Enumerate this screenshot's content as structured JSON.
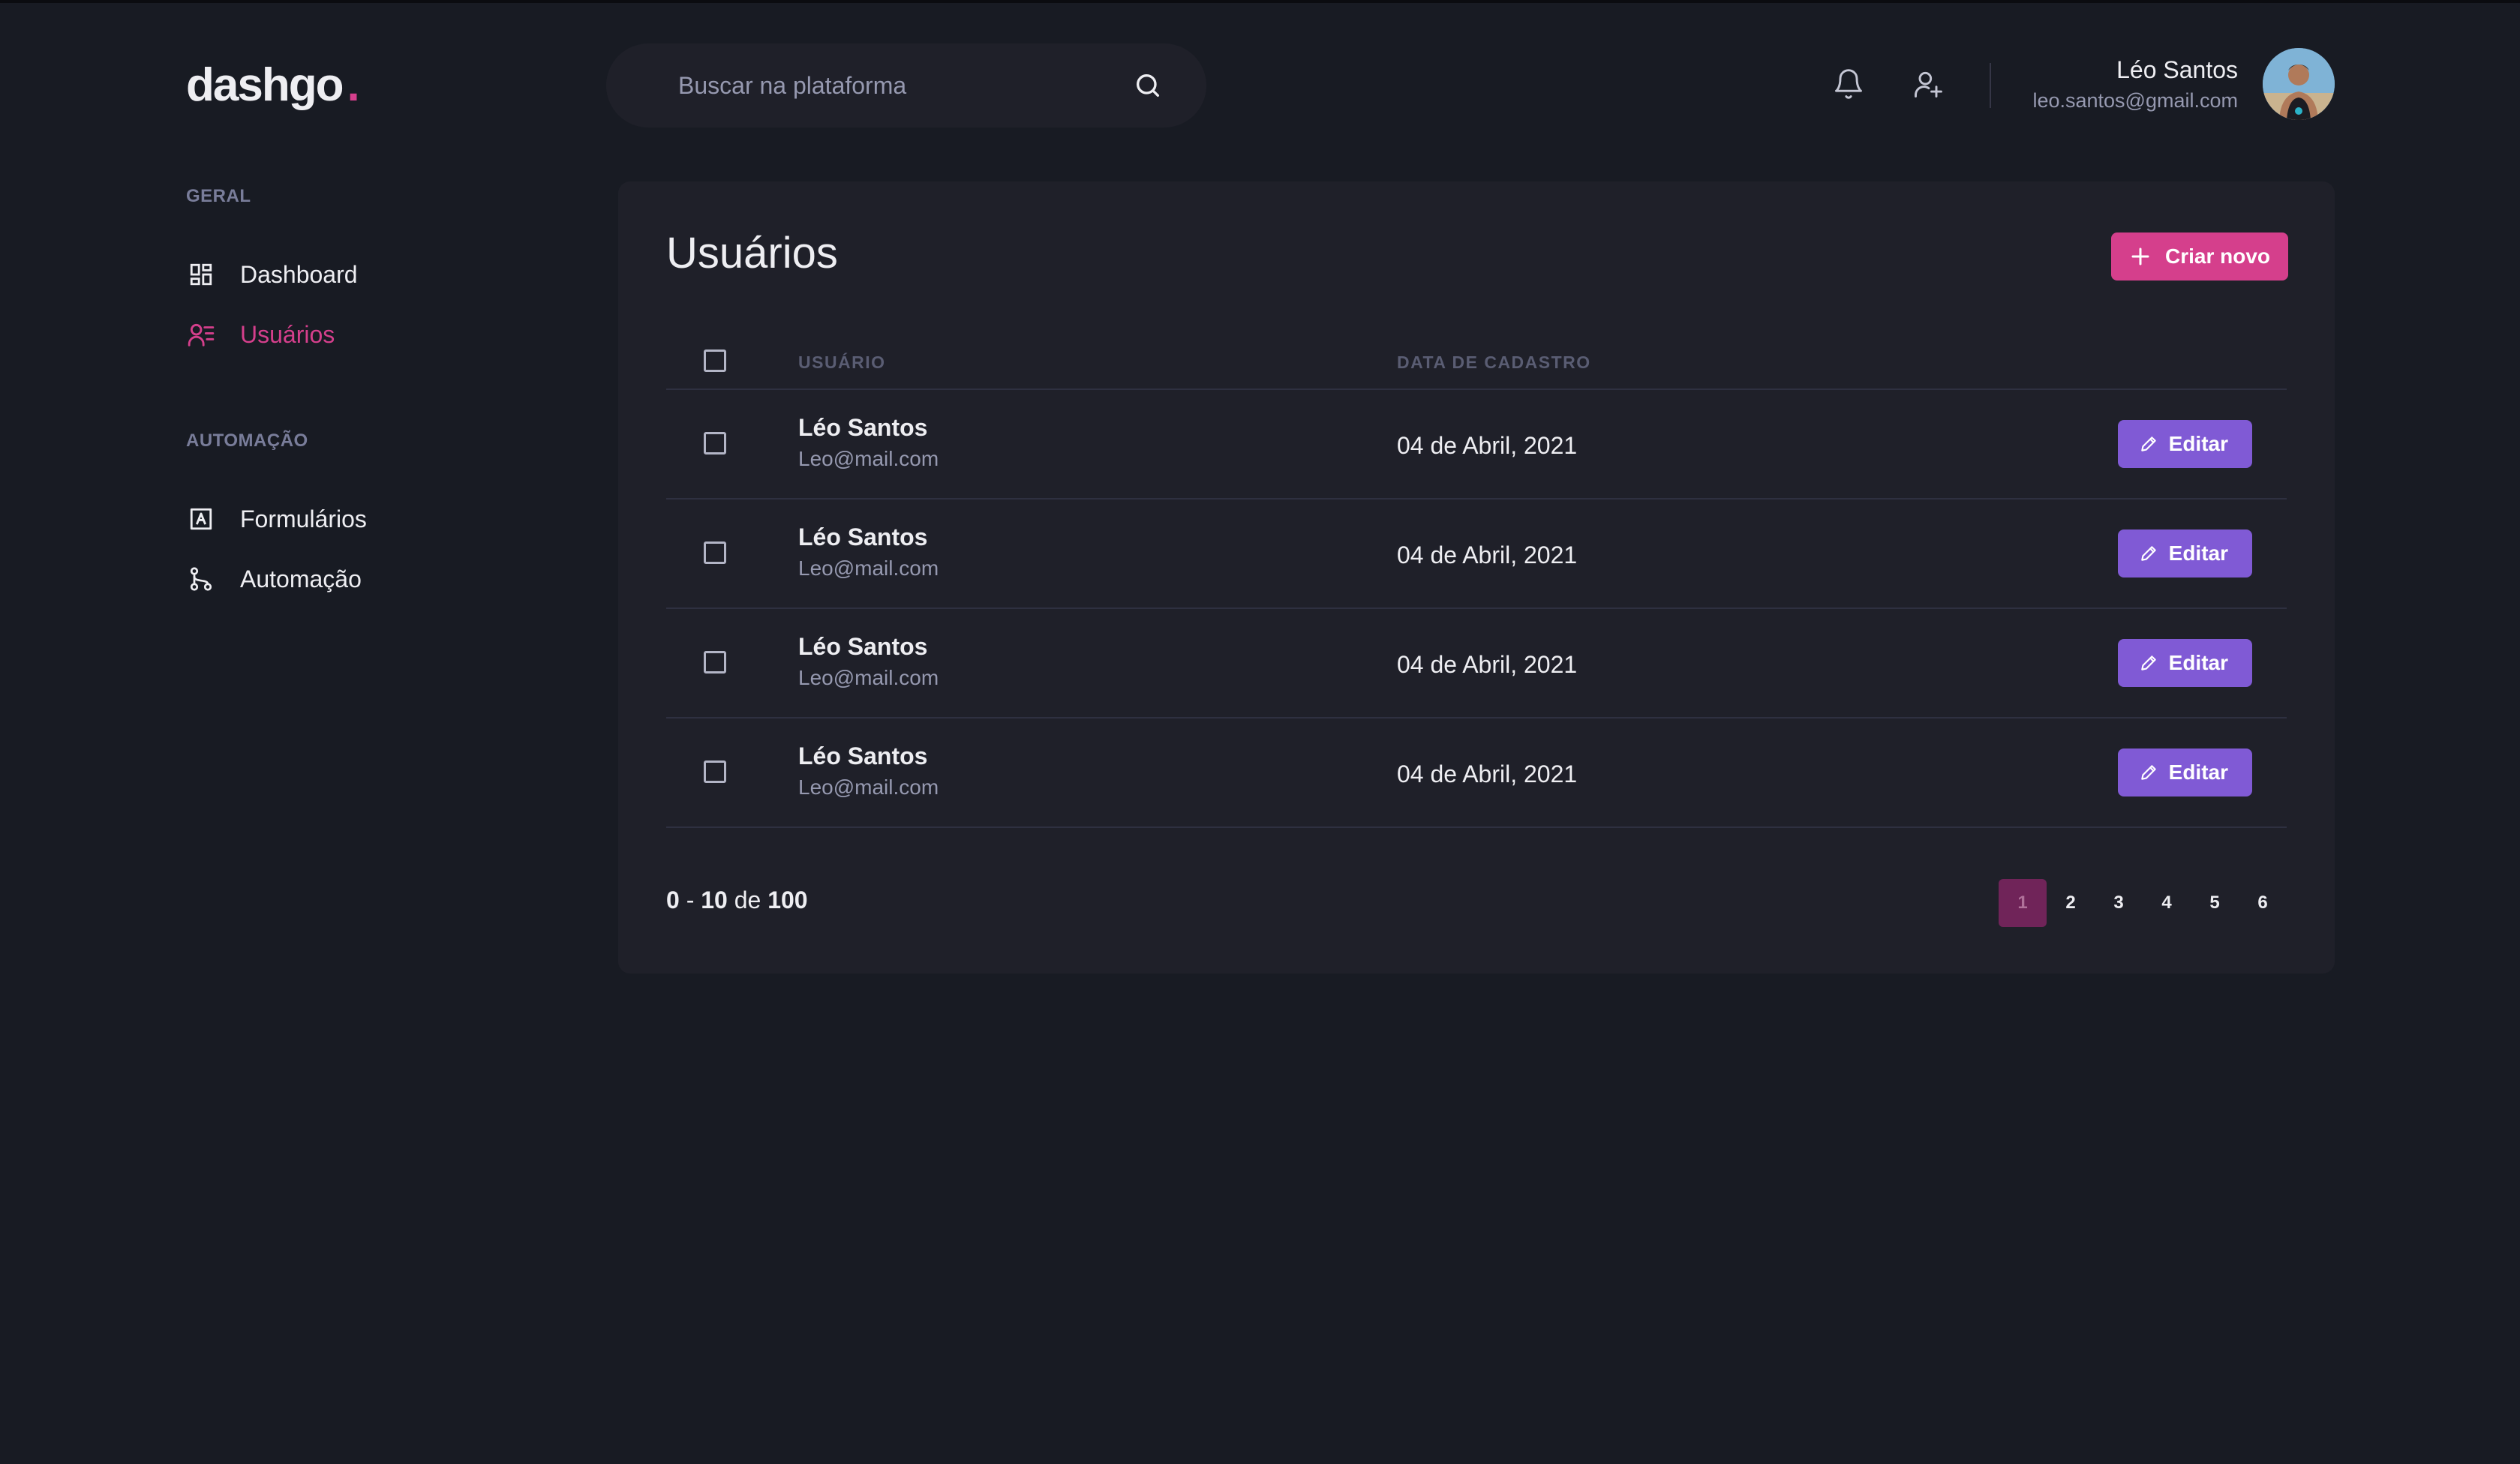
{
  "header": {
    "logo_text": "dashgo",
    "logo_dot": ".",
    "search_placeholder": "Buscar na plataforma",
    "profile": {
      "name": "Léo Santos",
      "email": "leo.santos@gmail.com"
    }
  },
  "sidebar": {
    "sections": [
      {
        "title": "GERAL",
        "items": [
          {
            "label": "Dashboard",
            "icon": "dashboard-icon"
          },
          {
            "label": "Usuários",
            "icon": "users-icon",
            "active": true
          }
        ]
      },
      {
        "title": "AUTOMAÇÃO",
        "items": [
          {
            "label": "Formulários",
            "icon": "form-icon"
          },
          {
            "label": "Automação",
            "icon": "git-branch-icon"
          }
        ]
      }
    ]
  },
  "main": {
    "title": "Usuários",
    "create_button": "Criar novo",
    "columns": {
      "user": "USUÁRIO",
      "date": "DATA DE CADASTRO"
    },
    "rows": [
      {
        "name": "Léo Santos",
        "email": "Leo@mail.com",
        "date": "04 de Abril, 2021",
        "action": "Editar"
      },
      {
        "name": "Léo Santos",
        "email": "Leo@mail.com",
        "date": "04 de Abril, 2021",
        "action": "Editar"
      },
      {
        "name": "Léo Santos",
        "email": "Leo@mail.com",
        "date": "04 de Abril, 2021",
        "action": "Editar"
      },
      {
        "name": "Léo Santos",
        "email": "Leo@mail.com",
        "date": "04 de Abril, 2021",
        "action": "Editar"
      }
    ],
    "pagination": {
      "from": "0",
      "to": "10",
      "of_word": "de",
      "total": "100",
      "pages": [
        "1",
        "2",
        "3",
        "4",
        "5",
        "6"
      ],
      "current": "1"
    }
  },
  "colors": {
    "background": "#181b23",
    "card": "#1f2029",
    "accent_pink": "#d53f8c",
    "accent_purple": "#805ad5",
    "muted": "#9699b0"
  }
}
